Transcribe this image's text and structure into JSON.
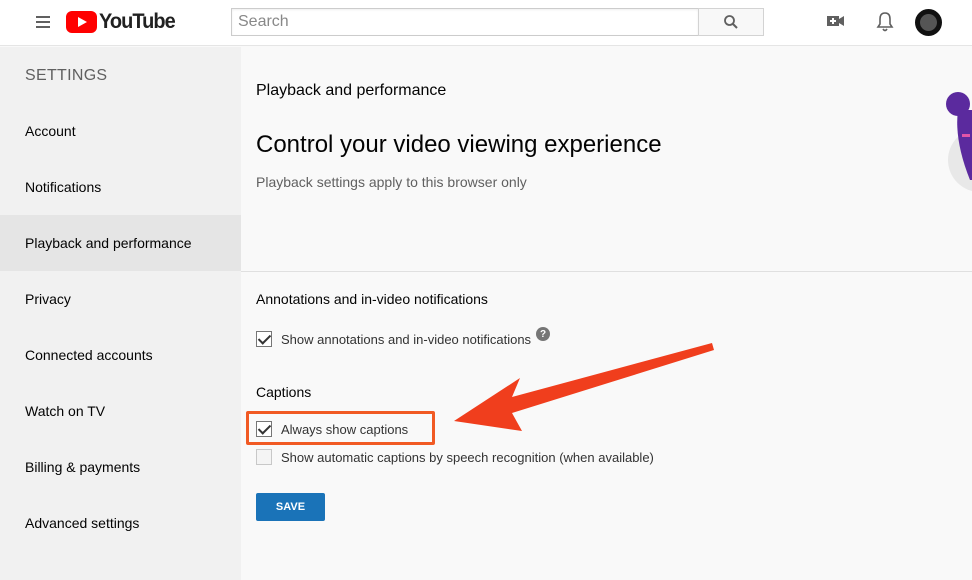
{
  "header": {
    "logo_text": "YouTube",
    "search_placeholder": "Search"
  },
  "sidebar": {
    "title": "SETTINGS",
    "items": [
      {
        "label": "Account"
      },
      {
        "label": "Notifications"
      },
      {
        "label": "Playback and performance",
        "active": true
      },
      {
        "label": "Privacy"
      },
      {
        "label": "Connected accounts"
      },
      {
        "label": "Watch on TV"
      },
      {
        "label": "Billing & payments"
      },
      {
        "label": "Advanced settings"
      }
    ]
  },
  "main": {
    "section_label": "Playback and performance",
    "headline": "Control your video viewing experience",
    "subhead": "Playback settings apply to this browser only",
    "annotations": {
      "title": "Annotations and in-video notifications",
      "option_label": "Show annotations and in-video notifications",
      "checked": true,
      "help_glyph": "?"
    },
    "captions": {
      "title": "Captions",
      "options": [
        {
          "label": "Always show captions",
          "checked": true
        },
        {
          "label": "Show automatic captions by speech recognition (when available)",
          "checked": false
        }
      ]
    },
    "save_label": "SAVE"
  },
  "colors": {
    "accent": "#1a73b8",
    "annotation_red": "#f15a24",
    "youtube_red": "#ff0000"
  }
}
